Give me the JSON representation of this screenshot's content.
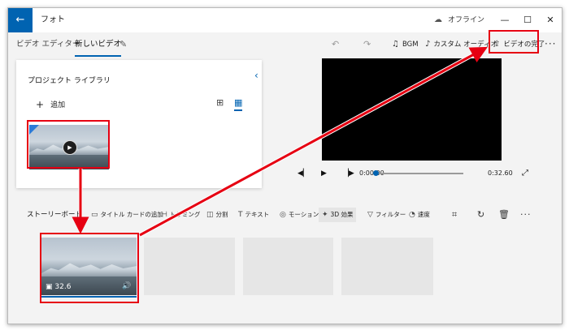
{
  "titlebar": {
    "back_icon": "back-arrow-icon",
    "app_title": "フォト",
    "status_icon": "cloud-offline-icon",
    "status_text": "オフライン",
    "minimize_symbol": "—",
    "maximize_symbol": "☐",
    "close_symbol": "✕"
  },
  "toolbar": {
    "breadcrumb_root": "ビデオ エディター",
    "breadcrumb_current": "新しいビデオ",
    "rename_icon": "pencil-icon",
    "undo_icon": "undo-icon",
    "redo_icon": "redo-icon",
    "bgm_label": "BGM",
    "custom_audio_label": "カスタム オーディオ",
    "finish_label": "ビデオの完了",
    "more_label": "···"
  },
  "library": {
    "title": "プロジェクト ライブラリ",
    "collapse_icon": "chevron-left-icon",
    "add_label": "追加",
    "view_icons": [
      "grid-large-icon",
      "grid-small-icon"
    ]
  },
  "preview": {
    "current_time": "0:00.00",
    "total_time": "0:32.60",
    "progress": 0
  },
  "storyboard": {
    "title": "ストーリーボード",
    "tools": [
      "タイトル カードの追加",
      "トリミング",
      "分割",
      "テキスト",
      "モーション",
      "3D 効果",
      "フィルター",
      "速度"
    ],
    "tool_icons": [
      "title-card-icon",
      "trim-icon",
      "split-icon",
      "text-icon",
      "motion-icon",
      "3d-effects-icon",
      "filter-icon",
      "speed-icon"
    ],
    "right_icons": [
      "crop-icon",
      "rotate-icon",
      "delete-icon",
      "more-icon"
    ],
    "clip_duration": "32.6"
  },
  "colors": {
    "accent": "#0063b1",
    "highlight_red": "#e60012",
    "window_bg": "#f3f3f3"
  }
}
